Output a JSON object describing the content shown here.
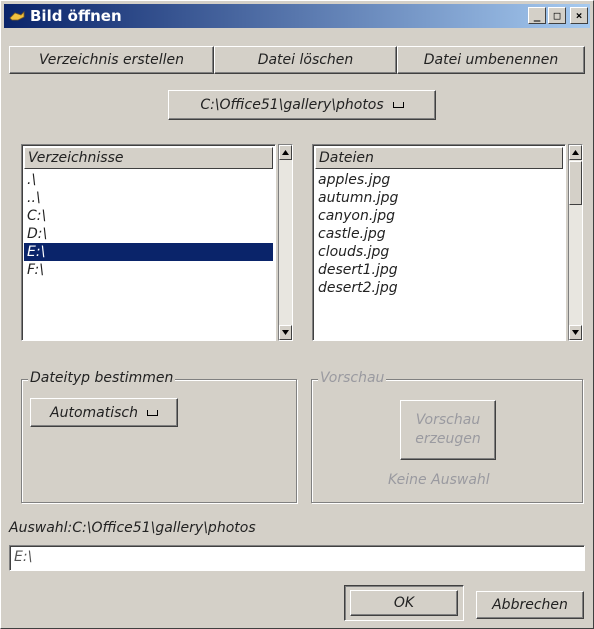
{
  "window": {
    "title": "Bild öffnen",
    "controls": {
      "minimize": "_",
      "maximize": "□",
      "close": "×"
    }
  },
  "toolbar": {
    "create_dir": "Verzeichnis erstellen",
    "delete_file": "Datei löschen",
    "rename_file": "Datei umbenennen"
  },
  "path_dropdown": {
    "value": "C:\\Office51\\gallery\\photos"
  },
  "directories": {
    "header": "Verzeichnisse",
    "items": [
      ".\\",
      "..\\",
      "C:\\",
      "D:\\",
      "E:\\",
      "F:\\"
    ],
    "selected_index": 4
  },
  "files": {
    "header": "Dateien",
    "items": [
      "apples.jpg",
      "autumn.jpg",
      "canyon.jpg",
      "castle.jpg",
      "clouds.jpg",
      "desert1.jpg",
      "desert2.jpg"
    ]
  },
  "filetype": {
    "legend": "Dateityp bestimmen",
    "value": "Automatisch"
  },
  "preview": {
    "legend": "Vorschau",
    "button_line1": "Vorschau",
    "button_line2": "erzeugen",
    "status": "Keine Auswahl"
  },
  "selection": {
    "label": "Auswahl:C:\\Office51\\gallery\\photos",
    "value": "E:\\"
  },
  "footer": {
    "ok": "OK",
    "cancel": "Abbrechen"
  },
  "colors": {
    "title_start": "#0a246a",
    "title_end": "#a6caf0",
    "selection": "#0a246a",
    "face": "#d4d0c8"
  }
}
